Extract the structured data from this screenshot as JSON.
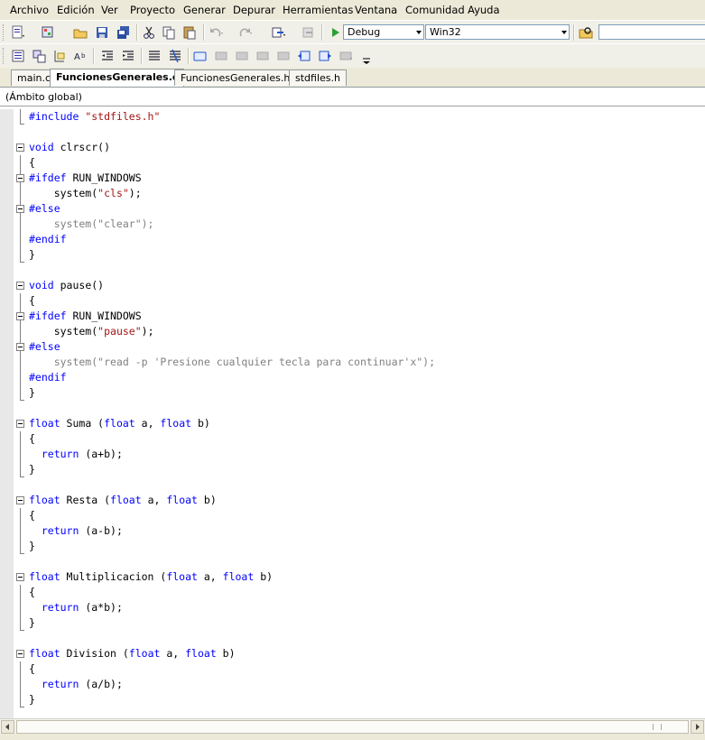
{
  "menu": [
    "Archivo",
    "Edición",
    "Ver",
    "Proyecto",
    "Generar",
    "Depurar",
    "Herramientas",
    "Ventana",
    "Comunidad",
    "Ayuda"
  ],
  "toolbar": {
    "config_value": "Debug",
    "platform_value": "Win32"
  },
  "tabs": [
    {
      "label": "main.c",
      "active": false
    },
    {
      "label": "FuncionesGenerales.c",
      "active": true
    },
    {
      "label": "FuncionesGenerales.h",
      "active": false
    },
    {
      "label": "stdfiles.h",
      "active": false
    }
  ],
  "scope": "(Ámbito global)",
  "code_lines": [
    [
      [
        "#include ",
        "kw"
      ],
      [
        "\"stdfiles.h\"",
        "str"
      ]
    ],
    [],
    [
      [
        "void",
        "kw"
      ],
      [
        " clrscr()",
        ""
      ]
    ],
    [
      [
        "{",
        ""
      ]
    ],
    [
      [
        "#ifdef",
        "kw"
      ],
      [
        " RUN_WINDOWS",
        ""
      ]
    ],
    [
      [
        "    system(",
        ""
      ],
      [
        "\"cls\"",
        "str"
      ],
      [
        ");",
        ""
      ]
    ],
    [
      [
        "#else",
        "kw"
      ]
    ],
    [
      [
        "    system(\"clear\");",
        "gray"
      ]
    ],
    [
      [
        "#endif",
        "kw"
      ]
    ],
    [
      [
        "}",
        ""
      ]
    ],
    [],
    [
      [
        "void",
        "kw"
      ],
      [
        " pause()",
        ""
      ]
    ],
    [
      [
        "{",
        ""
      ]
    ],
    [
      [
        "#ifdef",
        "kw"
      ],
      [
        " RUN_WINDOWS",
        ""
      ]
    ],
    [
      [
        "    system(",
        ""
      ],
      [
        "\"pause\"",
        "str"
      ],
      [
        ");",
        ""
      ]
    ],
    [
      [
        "#else",
        "kw"
      ]
    ],
    [
      [
        "    system(\"read -p 'Presione cualquier tecla para continuar'x\");",
        "gray"
      ]
    ],
    [
      [
        "#endif",
        "kw"
      ]
    ],
    [
      [
        "}",
        ""
      ]
    ],
    [],
    [
      [
        "float",
        "kw"
      ],
      [
        " Suma (",
        ""
      ],
      [
        "float",
        "kw"
      ],
      [
        " a, ",
        ""
      ],
      [
        "float",
        "kw"
      ],
      [
        " b)",
        ""
      ]
    ],
    [
      [
        "{",
        ""
      ]
    ],
    [
      [
        "  ",
        ""
      ],
      [
        "return",
        "kw"
      ],
      [
        " (a+b);",
        ""
      ]
    ],
    [
      [
        "}",
        ""
      ]
    ],
    [],
    [
      [
        "float",
        "kw"
      ],
      [
        " Resta (",
        ""
      ],
      [
        "float",
        "kw"
      ],
      [
        " a, ",
        ""
      ],
      [
        "float",
        "kw"
      ],
      [
        " b)",
        ""
      ]
    ],
    [
      [
        "{",
        ""
      ]
    ],
    [
      [
        "  ",
        ""
      ],
      [
        "return",
        "kw"
      ],
      [
        " (a-b);",
        ""
      ]
    ],
    [
      [
        "}",
        ""
      ]
    ],
    [],
    [
      [
        "float",
        "kw"
      ],
      [
        " Multiplicacion (",
        ""
      ],
      [
        "float",
        "kw"
      ],
      [
        " a, ",
        ""
      ],
      [
        "float",
        "kw"
      ],
      [
        " b)",
        ""
      ]
    ],
    [
      [
        "{",
        ""
      ]
    ],
    [
      [
        "  ",
        ""
      ],
      [
        "return",
        "kw"
      ],
      [
        " (a*b);",
        ""
      ]
    ],
    [
      [
        "}",
        ""
      ]
    ],
    [],
    [
      [
        "float",
        "kw"
      ],
      [
        " Division (",
        ""
      ],
      [
        "float",
        "kw"
      ],
      [
        " a, ",
        ""
      ],
      [
        "float",
        "kw"
      ],
      [
        " b)",
        ""
      ]
    ],
    [
      [
        "{",
        ""
      ]
    ],
    [
      [
        "  ",
        ""
      ],
      [
        "return",
        "kw"
      ],
      [
        " (a/b);",
        ""
      ]
    ],
    [
      [
        "}",
        ""
      ]
    ]
  ],
  "colors": {
    "keyword": "#0000ff",
    "string": "#a31515",
    "inactive_code": "#808080"
  }
}
